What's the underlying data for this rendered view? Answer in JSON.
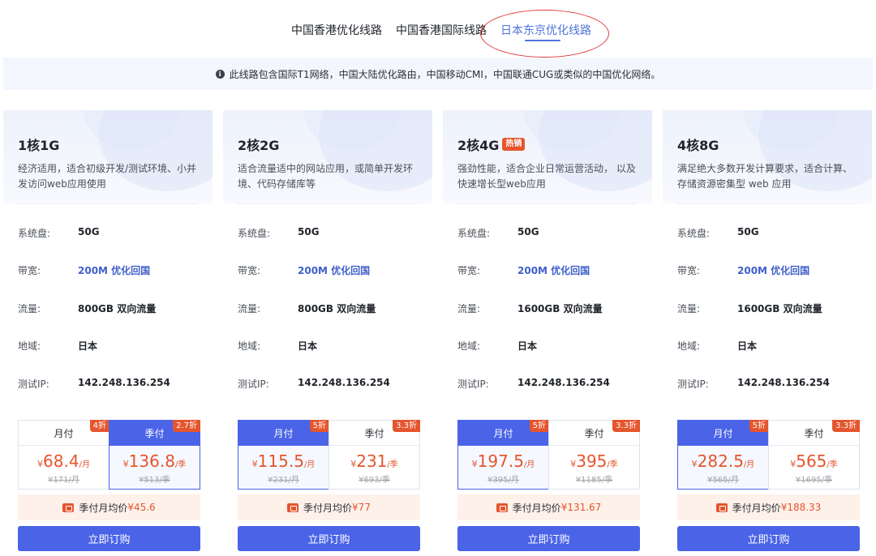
{
  "tabs": [
    {
      "label": "中国香港优化线路",
      "active": false
    },
    {
      "label": "中国香港国际线路",
      "active": false
    },
    {
      "label": "日本东京优化线路",
      "active": true
    }
  ],
  "notice": {
    "icon": "info-icon",
    "text": "此线路包含国际T1网络，中国大陆优化路由，中国移动CMI，中国联通CUG或类似的中国优化网络。"
  },
  "spec_labels": {
    "disk": "系统盘:",
    "bandwidth": "带宽:",
    "traffic": "流量:",
    "region": "地域:",
    "test_ip": "测试IP:"
  },
  "plans": [
    {
      "name": "1核1G",
      "badge": "",
      "desc": "经济适用，适合初级开发/测试环境、小并发访问web应用使用",
      "disk": "50G",
      "bandwidth": "200M 优化回国",
      "traffic": "800GB 双向流量",
      "region": "日本",
      "test_ip": "142.248.136.254",
      "options": [
        {
          "label": "月付",
          "discount": "4折",
          "currency": "¥",
          "price": "68.4",
          "unit": "/月",
          "original": "¥171/月",
          "selected": false
        },
        {
          "label": "季付",
          "discount": "2.7折",
          "currency": "¥",
          "price": "136.8",
          "unit": "/季",
          "original": "¥513/季",
          "selected": true
        }
      ],
      "avg_label": "季付月均价",
      "avg_price": "¥45.6",
      "buy_label": "立即订购"
    },
    {
      "name": "2核2G",
      "badge": "",
      "desc": "适合流量适中的网站应用，或简单开发环境、代码存储库等",
      "disk": "50G",
      "bandwidth": "200M 优化回国",
      "traffic": "800GB 双向流量",
      "region": "日本",
      "test_ip": "142.248.136.254",
      "options": [
        {
          "label": "月付",
          "discount": "5折",
          "currency": "¥",
          "price": "115.5",
          "unit": "/月",
          "original": "¥231/月",
          "selected": true
        },
        {
          "label": "季付",
          "discount": "3.3折",
          "currency": "¥",
          "price": "231",
          "unit": "/季",
          "original": "¥693/季",
          "selected": false
        }
      ],
      "avg_label": "季付月均价",
      "avg_price": "¥77",
      "buy_label": "立即订购"
    },
    {
      "name": "2核4G",
      "badge": "热销",
      "desc": "强劲性能，适合企业日常运营活动， 以及快速增长型web应用",
      "disk": "50G",
      "bandwidth": "200M 优化回国",
      "traffic": "1600GB 双向流量",
      "region": "日本",
      "test_ip": "142.248.136.254",
      "options": [
        {
          "label": "月付",
          "discount": "5折",
          "currency": "¥",
          "price": "197.5",
          "unit": "/月",
          "original": "¥395/月",
          "selected": true
        },
        {
          "label": "季付",
          "discount": "3.3折",
          "currency": "¥",
          "price": "395",
          "unit": "/季",
          "original": "¥1185/季",
          "selected": false
        }
      ],
      "avg_label": "季付月均价",
      "avg_price": "¥131.67",
      "buy_label": "立即订购"
    },
    {
      "name": "4核8G",
      "badge": "",
      "desc": "满足绝大多数开发计算要求，适合计算、存储资源密集型 web 应用",
      "disk": "50G",
      "bandwidth": "200M 优化回国",
      "traffic": "1600GB 双向流量",
      "region": "日本",
      "test_ip": "142.248.136.254",
      "options": [
        {
          "label": "月付",
          "discount": "5折",
          "currency": "¥",
          "price": "282.5",
          "unit": "/月",
          "original": "¥565/月",
          "selected": true
        },
        {
          "label": "季付",
          "discount": "3.3折",
          "currency": "¥",
          "price": "565",
          "unit": "/季",
          "original": "¥1695/季",
          "selected": false
        }
      ],
      "avg_label": "季付月均价",
      "avg_price": "¥188.33",
      "buy_label": "立即订购"
    }
  ],
  "colors": {
    "accent": "#4a63e7",
    "active_tab": "#4f74d8",
    "price": "#e5552d",
    "annotation_circle": "#e23a3a"
  }
}
